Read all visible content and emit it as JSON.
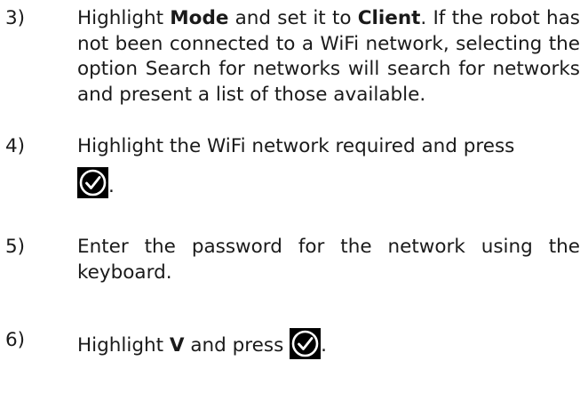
{
  "steps": [
    {
      "number": "3)",
      "parts": {
        "a": "Highlight ",
        "b": "Mode",
        "c": " and set it to ",
        "d": "Client",
        "e": ". If the robot has not been connected to a WiFi network, selecting the option Search for networks will search for networks and present a list of those available."
      }
    },
    {
      "number": "4)",
      "text": "Highlight the WiFi network required and press",
      "icon": "check-circle-icon",
      "after_icon": "."
    },
    {
      "number": "5)",
      "text": "Enter the password for the network using the keyboard."
    },
    {
      "number": "6)",
      "text_before": "Highlight ",
      "bold": "V",
      "text_after": " and press ",
      "icon": "check-circle-icon",
      "after_icon": "."
    }
  ],
  "colors": {
    "text": "#1a1a1a",
    "icon_background": "#000000",
    "icon_foreground": "#ffffff"
  }
}
